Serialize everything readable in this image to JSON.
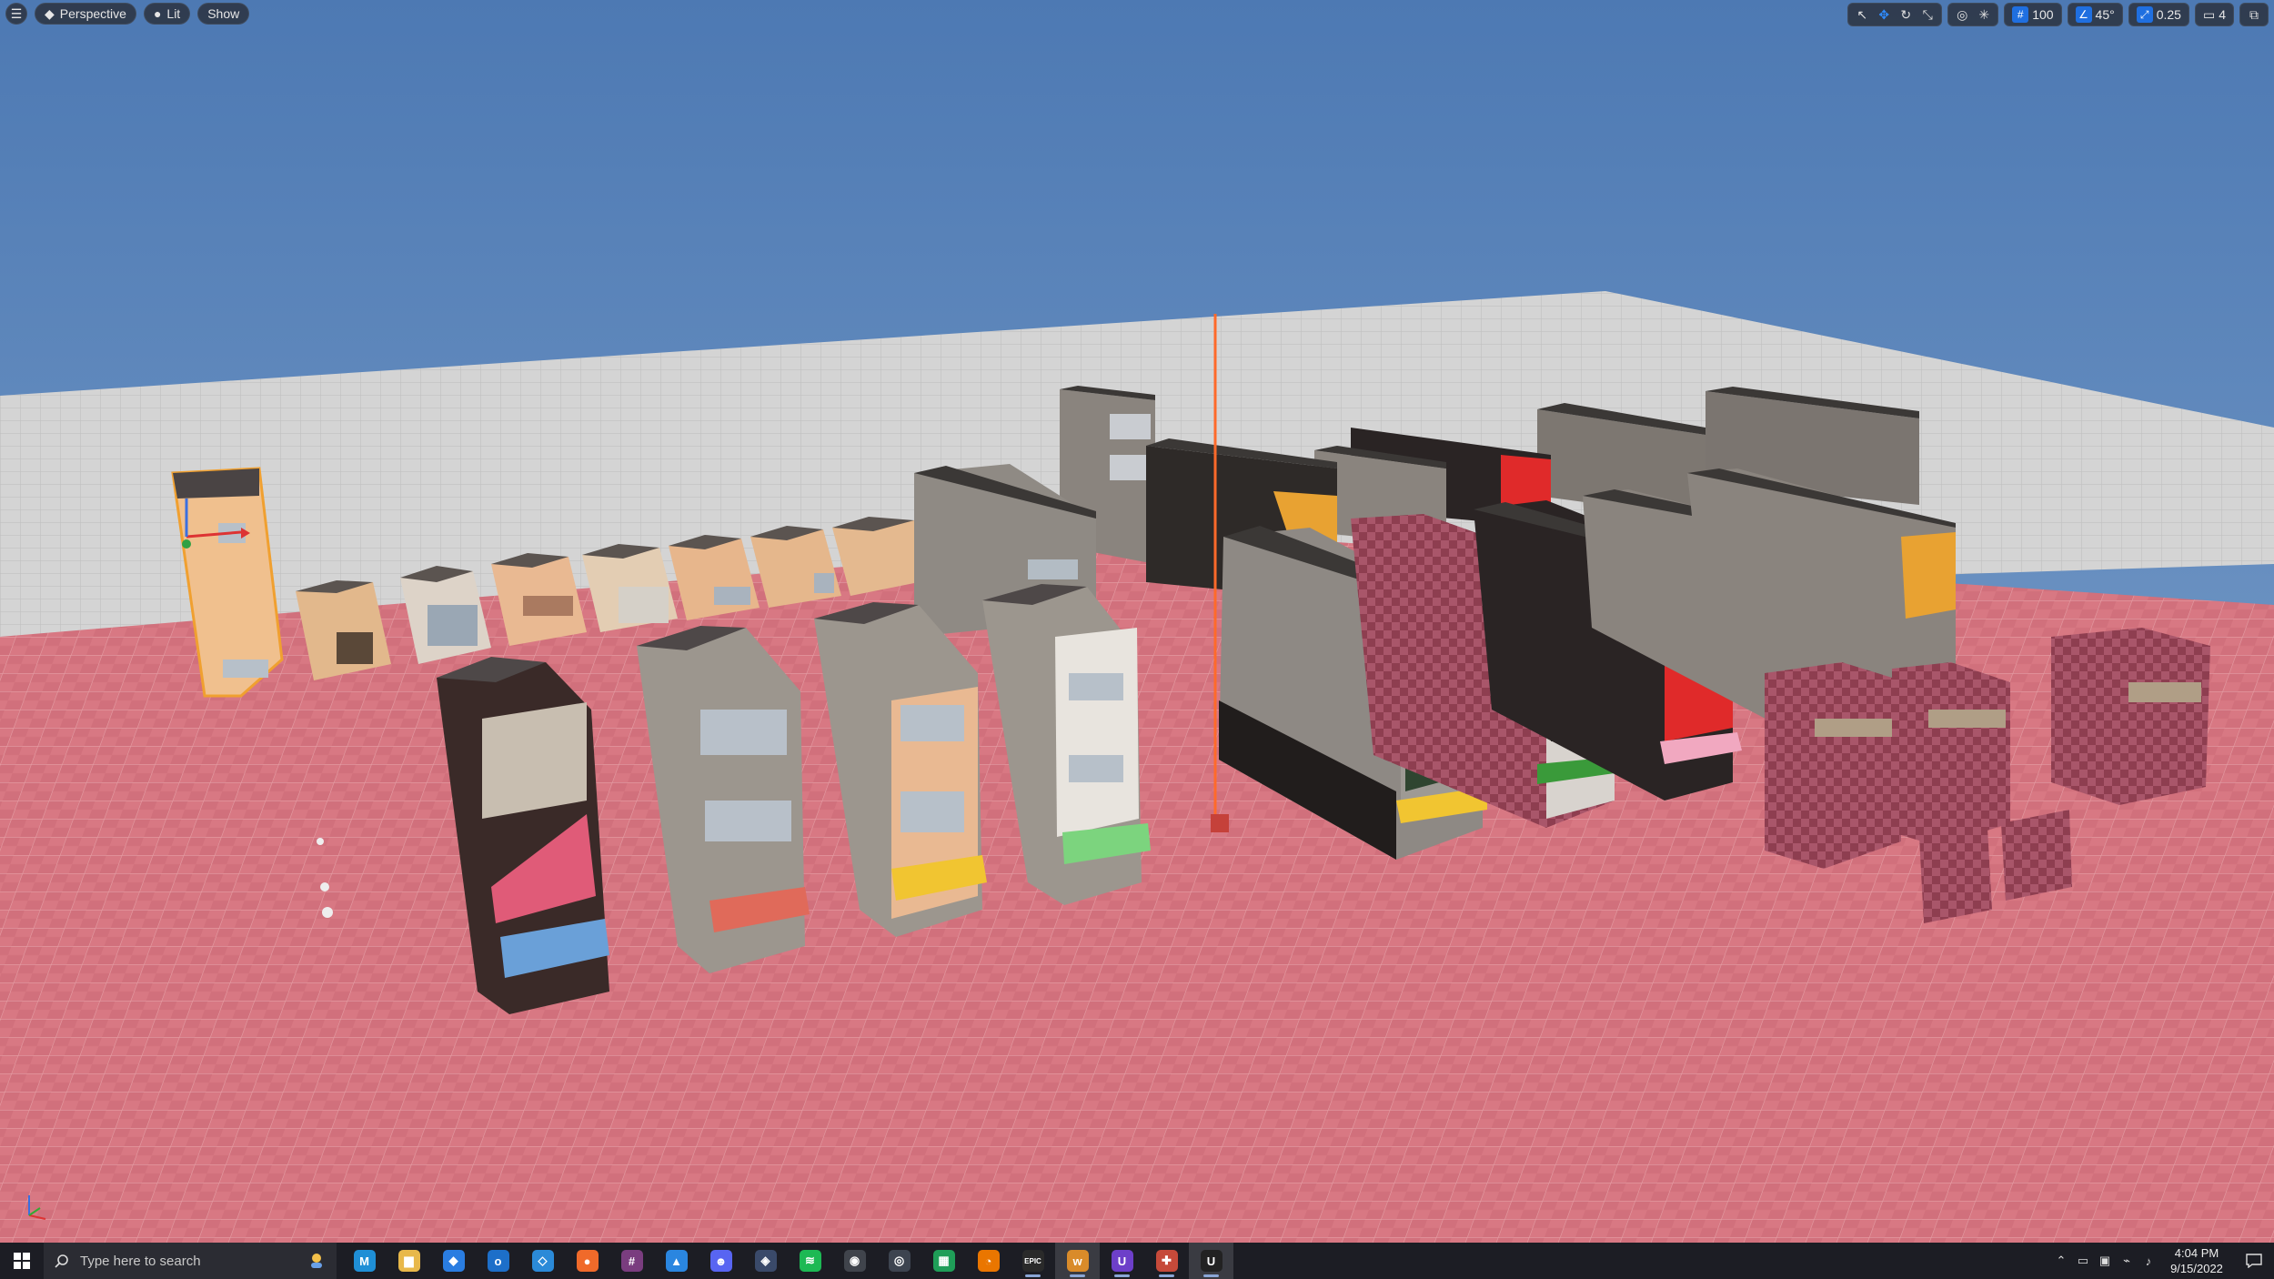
{
  "viewport": {
    "menu_icon": "hamburger-icon",
    "perspective_label": "Perspective",
    "lit_label": "Lit",
    "show_label": "Show",
    "grid_snap_value": "100",
    "rotation_snap_value": "45°",
    "scale_snap_value": "0.25",
    "camera_speed_value": "4",
    "accent_color": "#1f6fe0",
    "sky_color": "#6b93c0",
    "floor_color": "#d9737e",
    "backplane_color": "#cfcfcf",
    "selection_color": "#f0a030",
    "transform_tools": [
      "select-icon",
      "translate-icon",
      "rotate-icon",
      "scale-icon"
    ],
    "view_tools": [
      "realtime-icon",
      "surface-snap-icon"
    ]
  },
  "taskbar": {
    "search_placeholder": "Type here to search",
    "apps": [
      {
        "name": "vscode-app",
        "glyph": "M",
        "color": "#1f8fd6"
      },
      {
        "name": "file-explorer-app",
        "glyph": "▆",
        "color": "#e8b84a"
      },
      {
        "name": "shield-app",
        "glyph": "◆",
        "color": "#2a7de1"
      },
      {
        "name": "outlook-app",
        "glyph": "o",
        "color": "#1d6fc9"
      },
      {
        "name": "cube-app",
        "glyph": "◇",
        "color": "#2b8ad8"
      },
      {
        "name": "firefox-app",
        "glyph": "●",
        "color": "#f06a2a"
      },
      {
        "name": "slack-app",
        "glyph": "#",
        "color": "#7a3d7f"
      },
      {
        "name": "photos-app",
        "glyph": "▲",
        "color": "#2a86e0"
      },
      {
        "name": "discord-app",
        "glyph": "☻",
        "color": "#5865f2"
      },
      {
        "name": "davinci-app",
        "glyph": "◈",
        "color": "#3a4a6a"
      },
      {
        "name": "spotify-app",
        "glyph": "≋",
        "color": "#1db954"
      },
      {
        "name": "obs-app",
        "glyph": "◉",
        "color": "#40444c"
      },
      {
        "name": "steam-app",
        "glyph": "◎",
        "color": "#3d4450"
      },
      {
        "name": "sheets-app",
        "glyph": "▦",
        "color": "#1f9e58"
      },
      {
        "name": "blender-app",
        "glyph": "◔",
        "color": "#ea7600"
      },
      {
        "name": "epic-app",
        "glyph": "EPIC",
        "color": "#2a2a2a"
      },
      {
        "name": "w-app",
        "glyph": "w",
        "color": "#d98b2a"
      },
      {
        "name": "unreal-purple-app",
        "glyph": "U",
        "color": "#6d3fc9"
      },
      {
        "name": "tool-app",
        "glyph": "✚",
        "color": "#c64a3a"
      },
      {
        "name": "unreal-app",
        "glyph": "U",
        "color": "#222"
      }
    ],
    "time": "4:04 PM",
    "date": "9/15/2022"
  }
}
